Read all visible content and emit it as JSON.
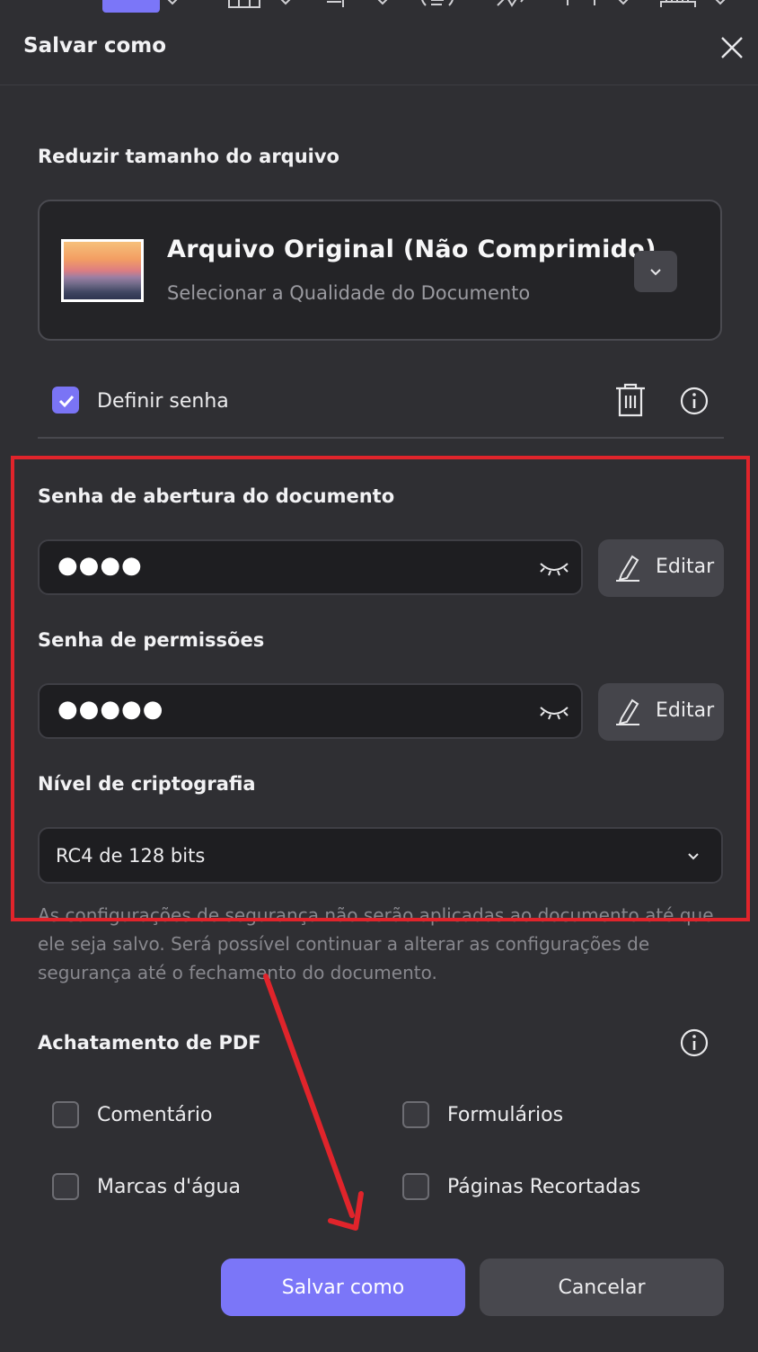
{
  "toolbar": {
    "icons": [
      "select-tool-icon",
      "chevron-down-icon",
      "table-icon",
      "chevron-down-icon",
      "measure-icon",
      "chevron-down-icon",
      "list-icon",
      "signature-icon",
      "crop-icon",
      "chevron-down-icon",
      "ruler-icon",
      "chevron-down-icon"
    ]
  },
  "dialog": {
    "title": "Salvar como",
    "close_icon": "close-icon"
  },
  "reduce": {
    "title": "Reduzir tamanho do arquivo",
    "card_title": "Arquivo Original (Não Comprimido)",
    "card_subtitle": "Selecionar a Qualidade do Documento",
    "dropdown_icon": "chevron-down-icon"
  },
  "password": {
    "set_label": "Definir senha",
    "set_checked": true,
    "open_title": "Senha de abertura do documento",
    "open_value": "●●●●",
    "perm_title": "Senha de permissões",
    "perm_value": "●●●●●",
    "edit_label": "Editar",
    "encryption_title": "Nível de criptografia",
    "encryption_value": "RC4 de 128 bits",
    "note": "As configurações de segurança não serão aplicadas ao documento até que ele seja salvo. Será possível continuar a alterar as configurações de segurança até o fechamento do documento."
  },
  "flatten": {
    "title": "Achatamento de PDF",
    "comment": "Comentário",
    "forms": "Formulários",
    "watermarks": "Marcas d'água",
    "cropped": "Páginas Recortadas"
  },
  "buttons": {
    "save": "Salvar como",
    "cancel": "Cancelar"
  },
  "colors": {
    "background": "#2f2f33",
    "accent": "#7b76f8",
    "annotation_red": "#e0242b"
  }
}
